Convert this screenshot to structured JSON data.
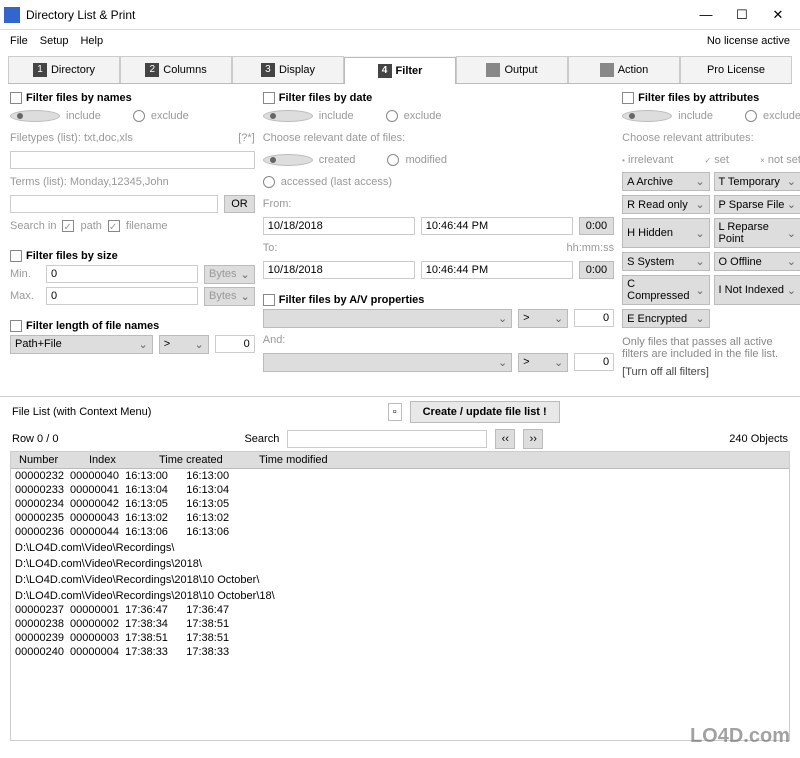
{
  "window": {
    "title": "Directory List & Print",
    "min": "—",
    "max": "☐",
    "close": "✕"
  },
  "menu": {
    "file": "File",
    "setup": "Setup",
    "help": "Help",
    "license": "No license active"
  },
  "tabs": [
    {
      "num": "1",
      "label": "Directory"
    },
    {
      "num": "2",
      "label": "Columns"
    },
    {
      "num": "3",
      "label": "Display"
    },
    {
      "num": "4",
      "label": "Filter",
      "active": true
    },
    {
      "icon": "doc",
      "label": "Output"
    },
    {
      "icon": "gear",
      "label": "Action"
    },
    {
      "label": "Pro License"
    }
  ],
  "filter_names": {
    "title": "Filter files by names",
    "include": "include",
    "exclude": "exclude",
    "filetypes_label": "Filetypes (list): txt,doc,xls",
    "filetypes_hint": "[?*]",
    "terms_label": "Terms (list): Monday,12345,John",
    "or": "OR",
    "search_in": "Search in",
    "path": "path",
    "filename": "filename"
  },
  "filter_size": {
    "title": "Filter files by size",
    "min": "Min.",
    "max": "Max.",
    "min_val": "0",
    "max_val": "0",
    "unit": "Bytes"
  },
  "filter_length": {
    "title": "Filter length of file names",
    "pathfile": "Path+File",
    "op": ">",
    "val": "0"
  },
  "filter_date": {
    "title": "Filter files by date",
    "include": "include",
    "exclude": "exclude",
    "choose": "Choose relevant date of files:",
    "created": "created",
    "modified": "modified",
    "accessed": "accessed (last access)",
    "from": "From:",
    "to": "To:",
    "date": "10/18/2018",
    "time": "10:46:44 PM",
    "hhmmss": "hh:mm:ss",
    "zero": "0:00"
  },
  "filter_av": {
    "title": "Filter files by A/V properties",
    "and": "And:",
    "op": ">",
    "val": "0"
  },
  "filter_attr": {
    "title": "Filter files by attributes",
    "include": "include",
    "exclude": "exclude",
    "choose": "Choose relevant attributes:",
    "irrelevant": "irrelevant",
    "set": "set",
    "notset": "not set",
    "items": [
      [
        "A  Archive",
        "T  Temporary"
      ],
      [
        "R  Read only",
        "P  Sparse File"
      ],
      [
        "H  Hidden",
        "L  Reparse Point"
      ],
      [
        "S  System",
        "O  Offline"
      ],
      [
        "C  Compressed",
        "I  Not Indexed"
      ],
      [
        "E  Encrypted",
        ""
      ]
    ],
    "note": "Only files that passes all active filters are included in the file list.",
    "turnoff": "[Turn off all filters]"
  },
  "filelist": {
    "title": "File List (with Context Menu)",
    "create": "Create / update file list !",
    "row": "Row 0 / 0",
    "search": "Search",
    "objects": "240 Objects",
    "headers": [
      "Number",
      "Index",
      "Time created",
      "Time modified"
    ],
    "rows": [
      "00000232  00000040  16:13:00      16:13:00",
      "00000233  00000041  16:13:04      16:13:04",
      "00000234  00000042  16:13:05      16:13:05",
      "00000235  00000043  16:13:02      16:13:02",
      "00000236  00000044  16:13:06      16:13:06",
      "",
      "D:\\LO4D.com\\Video\\Recordings\\",
      "",
      "D:\\LO4D.com\\Video\\Recordings\\2018\\",
      "",
      "D:\\LO4D.com\\Video\\Recordings\\2018\\10 October\\",
      "",
      "D:\\LO4D.com\\Video\\Recordings\\2018\\10 October\\18\\",
      "00000237  00000001  17:36:47      17:36:47",
      "00000238  00000002  17:38:34      17:38:51",
      "00000239  00000003  17:38:51      17:38:51",
      "00000240  00000004  17:38:33      17:38:33"
    ]
  },
  "watermark": "LO4D.com"
}
